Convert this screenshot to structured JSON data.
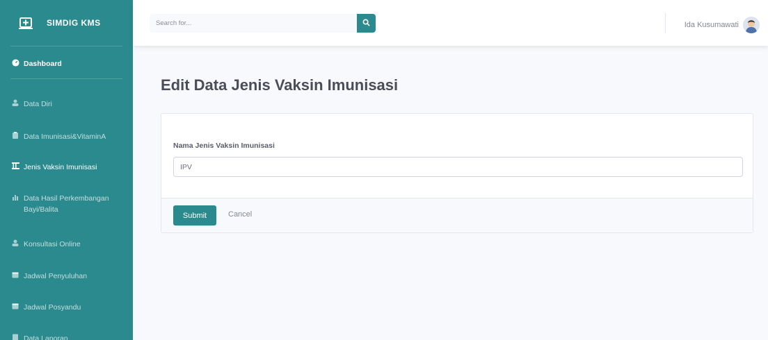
{
  "sidebar": {
    "brand": "SIMDIG KMS",
    "items": [
      {
        "label": "Dashboard",
        "icon": "tachometer-icon",
        "active": true
      },
      {
        "label": "Data Diri",
        "icon": "user-icon"
      },
      {
        "label": "Data Imunisasi&VitaminA",
        "icon": "clipboard-icon"
      },
      {
        "label": "Jenis Vaksin Imunisasi",
        "icon": "table-icon",
        "highlighted": true
      },
      {
        "label": "Data Hasil Perkembangan Bayi/Balita",
        "icon": "chart-icon"
      },
      {
        "label": "Konsultasi Online",
        "icon": "user-icon"
      },
      {
        "label": "Jadwal Penyuluhan",
        "icon": "calendar-icon"
      },
      {
        "label": "Jadwal Posyandu",
        "icon": "calendar-icon"
      },
      {
        "label": "Data Laporan",
        "icon": "file-icon"
      }
    ]
  },
  "topbar": {
    "search_placeholder": "Search for...",
    "user_name": "Ida Kusumawati"
  },
  "page": {
    "title": "Edit Data Jenis Vaksin Imunisasi"
  },
  "form": {
    "field_label": "Nama Jenis Vaksin Imunisasi",
    "field_value": "IPV",
    "submit_label": "Submit",
    "cancel_label": "Cancel"
  },
  "colors": {
    "accent": "#2a8a8e",
    "background": "#f8f9fc"
  }
}
